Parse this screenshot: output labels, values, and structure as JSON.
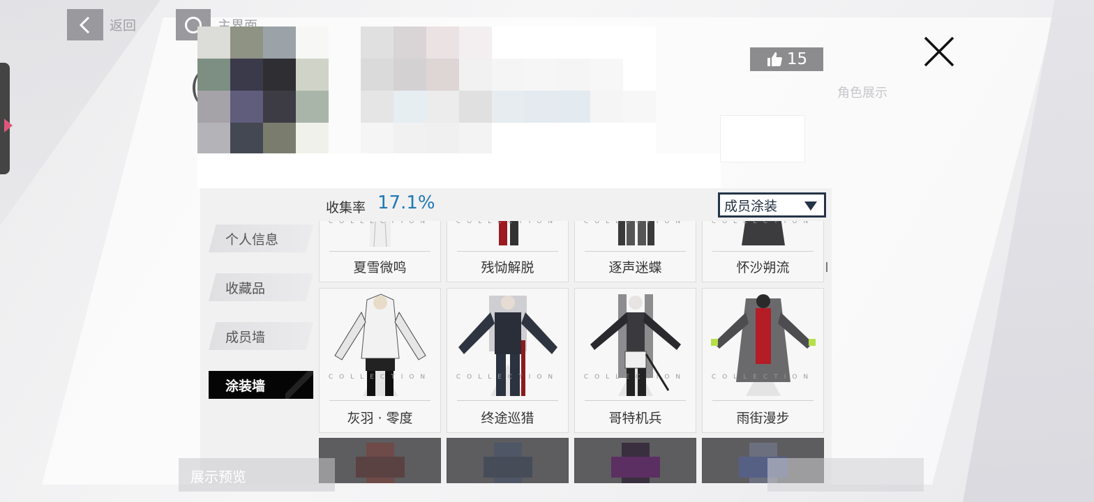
{
  "nav": {
    "back_label": "返回",
    "home_label": "主界面",
    "right_label": "角色展示"
  },
  "like": {
    "count": "15",
    "icon": "thumbs-up-icon"
  },
  "panel": {
    "collection_rate_label": "收集率",
    "collection_rate_value": "17.1%",
    "filter_selected": "成员涂装"
  },
  "menu": [
    {
      "label": "个人信息",
      "active": false
    },
    {
      "label": "收藏品",
      "active": false
    },
    {
      "label": "成员墙",
      "active": false
    },
    {
      "label": "涂装墙",
      "active": true
    }
  ],
  "collection_watermark": "COLLECTION",
  "skins_row1": [
    "夏雪微鸣",
    "残恸解脱",
    "逐声迷蝶",
    "怀沙朔流"
  ],
  "skins_row2": [
    "灰羽 · 零度",
    "终途巡猎",
    "哥特机兵",
    "雨街漫步"
  ],
  "bottom": {
    "preview_label": "展示预览"
  },
  "colors": {
    "accent": "#1f78b4",
    "active_menu": "#050505",
    "dropdown_border": "#243446"
  },
  "mosaic_a": [
    "#dcdcd8",
    "#8e9384",
    "#9ba3a8",
    "#f7f7f5",
    "#7c8f82",
    "#3b3a4a",
    "#2f2f33",
    "#d0d4c8",
    "#a5a2a8",
    "#5f5c7c",
    "#3d3c44",
    "#aab5aa",
    "#b4b4b8",
    "#444852",
    "#7a7d6e",
    "#f1f1eb"
  ],
  "mosaic_b": [
    "#e0e0e0",
    "#d9d4d6",
    "#ebe3e3",
    "#f3eff0",
    "#ffffff",
    "#ffffff",
    "#ffffff",
    "#ffffff",
    "#ffffff",
    "#dadada",
    "#d4d1d3",
    "#ddd6d4",
    "#f1f1f1",
    "#f5f5f5",
    "#f6f6f6",
    "#f5f5f5",
    "#f7f7f7",
    "#ffffff",
    "#e5e5e5",
    "#e6eef2",
    "#ececec",
    "#e0e0e0",
    "#e6ecf0",
    "#e4eaf0",
    "#e3ebf0",
    "#f5f5f5",
    "#f7f7f7",
    "#f5f5f5",
    "#f1f1f1",
    "#f0f0f0",
    "#f3f3f3",
    "#ffffff",
    "#ffffff",
    "#ffffff",
    "#ffffff",
    "#ffffff"
  ]
}
